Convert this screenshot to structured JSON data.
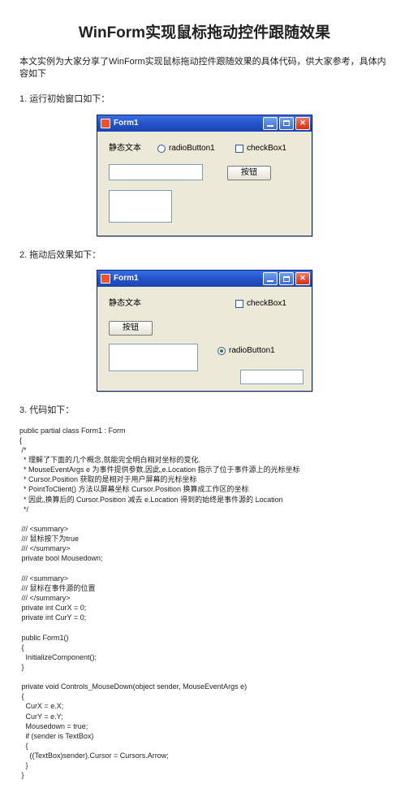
{
  "heading": "WinForm实现鼠标拖动控件跟随效果",
  "intro": "本文实例为大家分享了WinForm实现鼠标拖动控件跟随效果的具体代码，供大家参考，具体内容如下",
  "section1": "1. 运行初始窗口如下：",
  "section2": "2. 拖动后效果如下：",
  "section3": "3. 代码如下：",
  "window": {
    "title": "Form1",
    "label_static": "静态文本",
    "radio_label": "radioButton1",
    "check_label": "checkBox1",
    "button_label": "按钮"
  },
  "code": "public partial class Form1 : Form\n{\n /*\n  * 理解了下面的几个概念,就能完全明白相对坐标的变化.\n  * MouseEventArgs e 为事件提供参数,因此,e.Location 指示了位于事件源上的光标坐标\n  * Cursor.Position 获取的是相对于用户屏幕的光标坐标\n  * PointToClient() 方法以屏幕坐标 Cursor.Position 换算成工作区的坐标\n  * 因此,换算后的 Cursor.Position 减去 e.Location 得到的始终是事件源的 Location\n  */\n\n /// <summary>\n /// 鼠标按下为true\n /// </summary>\n private bool Mousedown;\n\n /// <summary>\n /// 鼠标在事件源的位置\n /// </summary>\n private int CurX = 0;\n private int CurY = 0;\n\n public Form1()\n {\n   InitializeComponent();\n }\n\n private void Controls_MouseDown(object sender, MouseEventArgs e)\n {\n   CurX = e.X;\n   CurY = e.Y;\n   Mousedown = true;\n   if (sender is TextBox)\n   {\n     ((TextBox)sender).Cursor = Cursors.Arrow;\n   }\n }"
}
